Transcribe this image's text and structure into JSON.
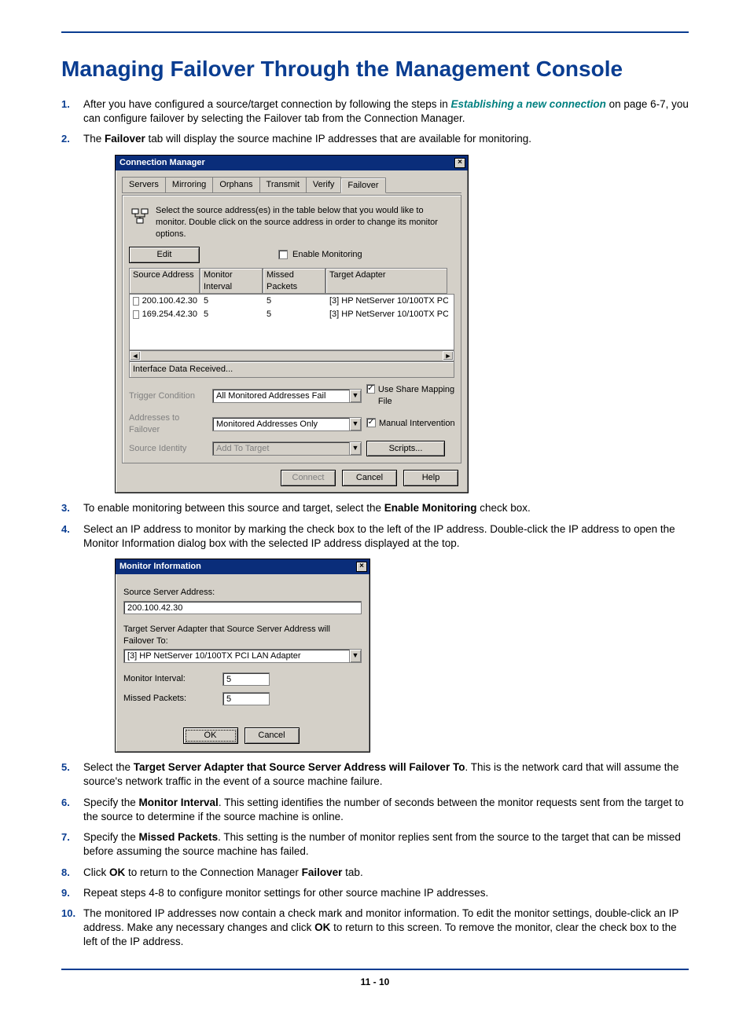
{
  "title": "Managing Failover Through the Management Console",
  "steps": {
    "s1_a": "After you have configured a source/target connection by following the steps in ",
    "s1_link": "Establishing a new connection",
    "s1_b": " on page 6-7, you can configure failover by selecting the Failover tab from the Connection Manager.",
    "s2_a": "The ",
    "s2_b": "Failover",
    "s2_c": " tab will display the source machine IP addresses that are available for monitoring.",
    "s3_a": "To enable monitoring between this source and target, select the ",
    "s3_b": "Enable Monitoring",
    "s3_c": " check box.",
    "s4": "Select an IP address to monitor by marking the check box to the left of the IP address. Double-click the IP address to open the Monitor Information dialog box with the selected IP address displayed at the top.",
    "s5_a": "Select the ",
    "s5_b": "Target Server Adapter that Source Server Address will Failover To",
    "s5_c": ". This is the network card that will assume the source's network traffic in the event of a source machine failure.",
    "s6_a": "Specify the ",
    "s6_b": "Monitor Interval",
    "s6_c": ". This setting identifies the number of seconds between the monitor requests sent from the target to the source to determine if the source machine is online.",
    "s7_a": "Specify the ",
    "s7_b": "Missed Packets",
    "s7_c": ". This setting is the number of monitor replies sent from the source to the target that can be missed before assuming the source machine has failed.",
    "s8_a": "Click ",
    "s8_b": "OK",
    "s8_c": " to return to the Connection Manager ",
    "s8_d": "Failover",
    "s8_e": " tab.",
    "s9": "Repeat steps 4-8 to configure monitor settings for other source machine IP addresses.",
    "s10_a": "The monitored IP addresses now contain a check mark and monitor information.  To edit the monitor settings, double-click an IP address. Make any necessary changes and click ",
    "s10_b": "OK",
    "s10_c": " to return to this screen. To remove the monitor, clear the check box to the left of the IP address."
  },
  "cm": {
    "title": "Connection Manager",
    "tabs": [
      "Servers",
      "Mirroring",
      "Orphans",
      "Transmit",
      "Verify",
      "Failover"
    ],
    "instruction": "Select the source address(es) in the table below that you would like to monitor. Double click on the source address in order to change its monitor options.",
    "edit": "Edit",
    "enable_monitoring": "Enable Monitoring",
    "cols": {
      "c1": "Source Address",
      "c2": "Monitor Interval",
      "c3": "Missed Packets",
      "c4": "Target Adapter"
    },
    "rows": [
      {
        "addr": "200.100.42.30",
        "mi": "5",
        "mp": "5",
        "ta": "[3] HP NetServer 10/100TX PC"
      },
      {
        "addr": "169.254.42.30",
        "mi": "5",
        "mp": "5",
        "ta": "[3] HP NetServer 10/100TX PC"
      }
    ],
    "status": "Interface Data Received...",
    "labels": {
      "trigger": "Trigger Condition",
      "atf": "Addresses to Failover",
      "si": "Source Identity"
    },
    "combos": {
      "trigger": "All Monitored Addresses Fail",
      "atf": "Monitored Addresses Only",
      "si": "Add To Target"
    },
    "checks": {
      "share": "Use Share Mapping File",
      "manual": "Manual Intervention"
    },
    "scripts": "Scripts...",
    "buttons": {
      "connect": "Connect",
      "cancel": "Cancel",
      "help": "Help"
    }
  },
  "mi": {
    "title": "Monitor Information",
    "lab_source": "Source Server Address:",
    "source_val": "200.100.42.30",
    "lab_target": "Target Server Adapter that Source Server Address will Failover To:",
    "target_val": "[3] HP NetServer 10/100TX PCI LAN Adapter",
    "lab_mi": "Monitor Interval:",
    "val_mi": "5",
    "lab_mp": "Missed Packets:",
    "val_mp": "5",
    "ok": "OK",
    "cancel": "Cancel"
  },
  "footer": "11 - 10"
}
